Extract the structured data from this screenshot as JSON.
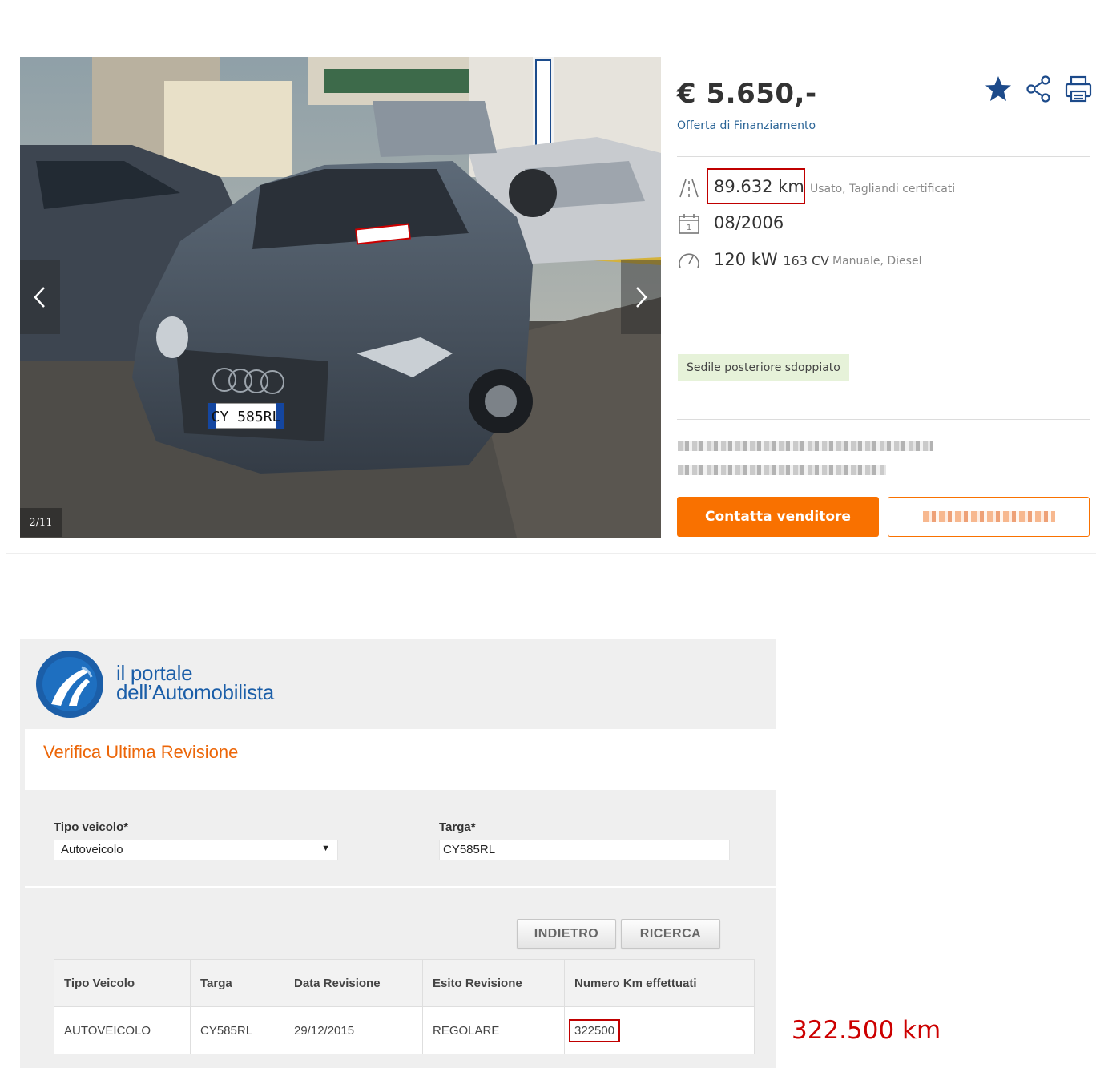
{
  "listing": {
    "photo_counter": "2/11",
    "price": "€ 5.650,-",
    "financing_link": "Offerta di Finanziamento",
    "actions": [
      "star-icon",
      "share-icon",
      "print-icon"
    ],
    "mileage": "89.632 km",
    "condition": "Usato, Tagliandi certificati",
    "registration": "08/2006",
    "power_kw": "120 kW",
    "power_cv": "163 CV",
    "transmission_fuel": "Manuale, Diesel",
    "feature_tag": "Sedile posteriore sdoppiato",
    "contact_button": "Contatta venditore",
    "accent_color": "#f97100",
    "link_color": "#2a6496",
    "highlight_color": "#c00000"
  },
  "portal": {
    "brand_line1": "il portale",
    "brand_line2": "dell’Automobilista",
    "title": "Verifica Ultima Revisione",
    "form": {
      "vehicle_type_label": "Tipo veicolo*",
      "vehicle_type_value": "Autoveicolo",
      "plate_label": "Targa*",
      "plate_value": "CY585RL"
    },
    "buttons": {
      "back": "INDIETRO",
      "search": "RICERCA"
    },
    "table": {
      "headers": [
        "Tipo Veicolo",
        "Targa",
        "Data Revisione",
        "Esito Revisione",
        "Numero Km effettuati"
      ],
      "rows": [
        [
          "AUTOVEICOLO",
          "CY585RL",
          "29/12/2015",
          "REGOLARE",
          "322500"
        ]
      ]
    },
    "brand_color": "#1b5ea8",
    "title_color": "#ec6608"
  },
  "annotation": {
    "real_km": "322.500 km"
  },
  "car_plate": "CY 585RL"
}
